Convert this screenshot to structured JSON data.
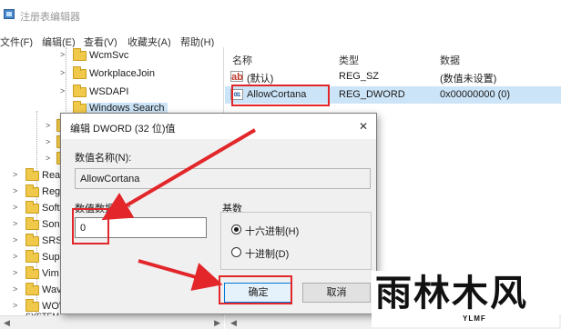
{
  "window": {
    "title": "注册表编辑器"
  },
  "menu": [
    "文件(F)",
    "编辑(E)",
    "查看(V)",
    "收藏夹(A)",
    "帮助(H)"
  ],
  "tree": {
    "items": [
      {
        "label": "WcmSvc",
        "expander": ">"
      },
      {
        "label": "WorkplaceJoin",
        "expander": ">"
      },
      {
        "label": "WSDAPI",
        "expander": ">"
      },
      {
        "label": "Windows Search",
        "expander": ""
      },
      {
        "label": "",
        "expander": ">"
      },
      {
        "label": "",
        "expander": ">"
      },
      {
        "label": "",
        "expander": ">"
      },
      {
        "label": "Realt",
        "expander": ">"
      },
      {
        "label": "Regis",
        "expander": ">"
      },
      {
        "label": "SoftE",
        "expander": ">"
      },
      {
        "label": "Sonic",
        "expander": ">"
      },
      {
        "label": "SRS I",
        "expander": ">"
      },
      {
        "label": "Supe",
        "expander": ">"
      },
      {
        "label": "Vim",
        "expander": ">"
      },
      {
        "label": "Wave",
        "expander": ">"
      },
      {
        "label": "WOW",
        "expander": ">"
      }
    ],
    "cut_off_label": "SYSTEM"
  },
  "list": {
    "headers": {
      "name": "名称",
      "type": "类型",
      "data": "数据"
    },
    "rows": [
      {
        "icon": "ab",
        "name": "(默认)",
        "type": "REG_SZ",
        "data": "(数值未设置)"
      },
      {
        "icon": "011",
        "name": "AllowCortana",
        "type": "REG_DWORD",
        "data": "0x00000000 (0)"
      }
    ]
  },
  "dialog": {
    "title": "编辑 DWORD (32 位)值",
    "close": "✕",
    "value_name_label": "数值名称(N):",
    "value_name": "AllowCortana",
    "value_data_label": "数值数据(V):",
    "value_data": "0",
    "base_label": "基数",
    "base_options": [
      {
        "label": "十六进制(H)",
        "checked": true
      },
      {
        "label": "十进制(D)",
        "checked": false
      }
    ],
    "ok_label": "确定",
    "cancel_label": "取消"
  },
  "watermark": {
    "text": "雨林木风",
    "sub": "YLMF"
  },
  "annotation_color": "#e2262a"
}
